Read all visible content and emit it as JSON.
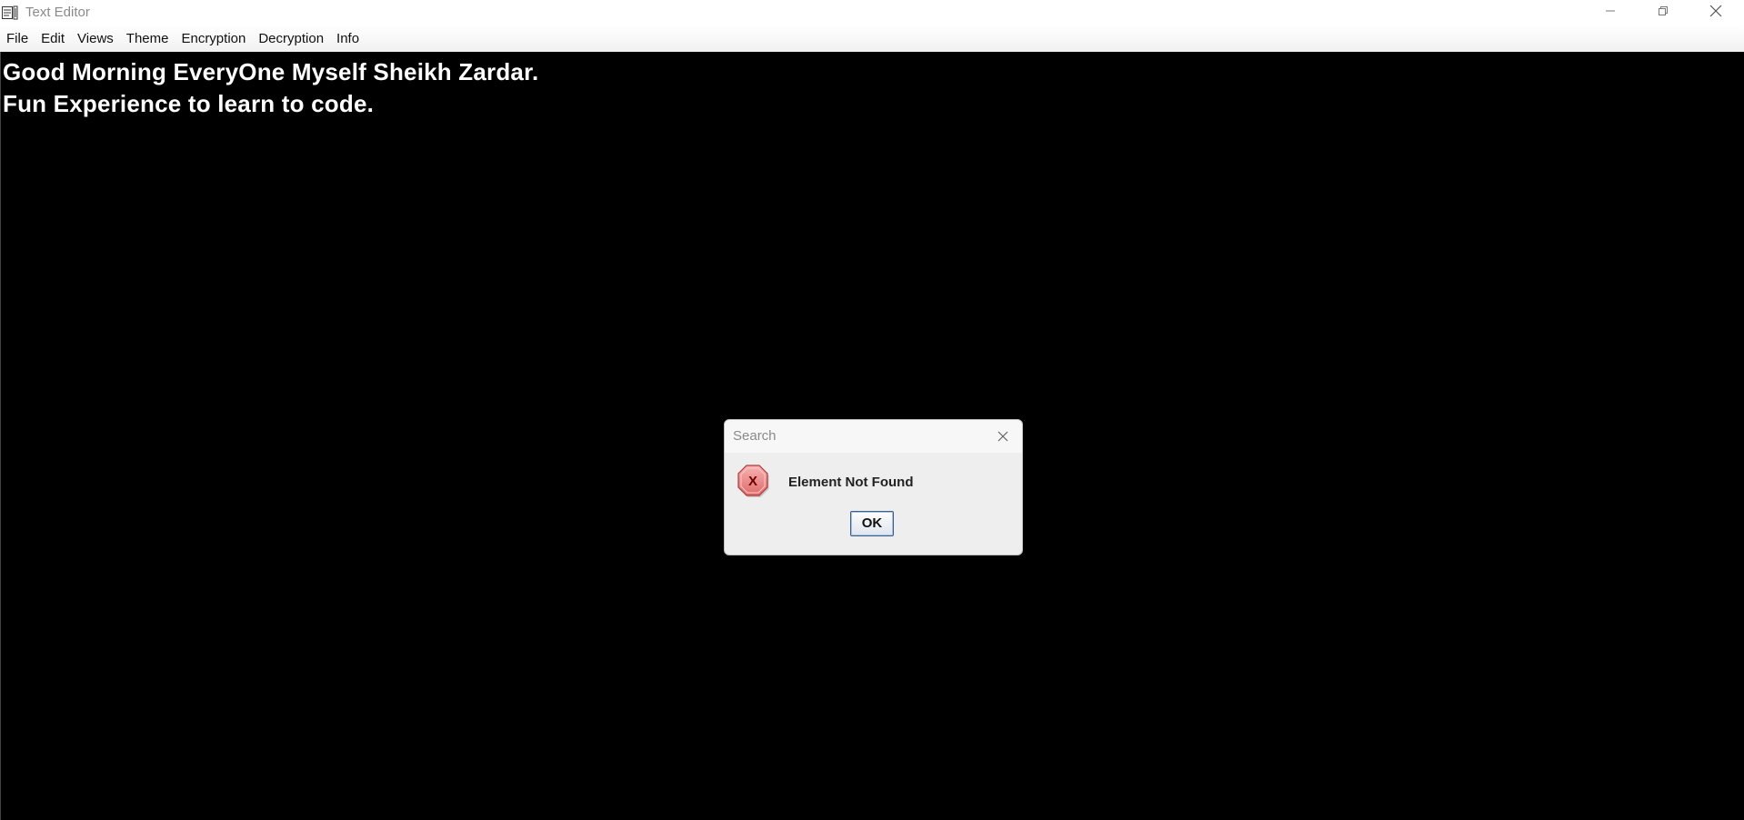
{
  "window": {
    "title": "Text Editor",
    "icon": "notepad-icon",
    "controls": [
      "minimize-icon",
      "restore-icon",
      "close-icon"
    ]
  },
  "menubar": {
    "items": [
      "File",
      "Edit",
      "Views",
      "Theme",
      "Encryption",
      "Decryption",
      "Info"
    ]
  },
  "editor": {
    "background": "#000000",
    "text_color": "#ffffff",
    "lines": [
      "Good Morning EveryOne Myself Sheikh Zardar.",
      "Fun Experience to learn to code."
    ]
  },
  "dialog": {
    "title": "Search",
    "icon": "error-icon",
    "message": "Element Not Found",
    "ok_label": "OK",
    "close_icon": "close-icon"
  }
}
